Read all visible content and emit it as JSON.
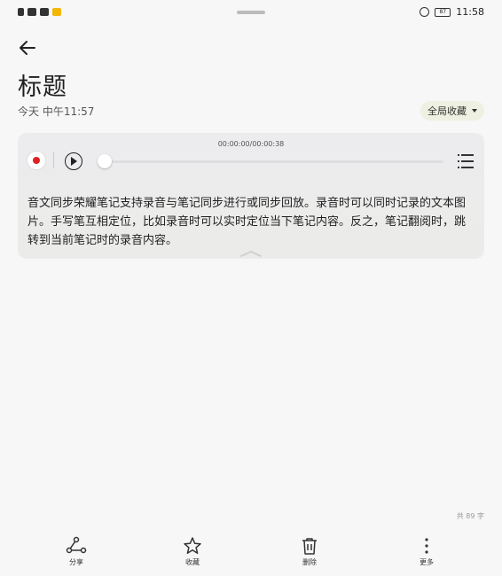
{
  "status_bar": {
    "time": "11:58",
    "battery": "87"
  },
  "note": {
    "title": "标题",
    "date": "今天 中午11:57",
    "category": "全局收藏",
    "body": "音文同步荣耀笔记支持录音与笔记同步进行或同步回放。录音时可以同时记录的文本图片。手写笔互相定位，比如录音时可以实时定位当下笔记内容。反之，笔记翻阅时，跳转到当前笔记时的录音内容。",
    "word_count": "共 89 字"
  },
  "player": {
    "time": "00:00:00/00:00:38",
    "progress": 0
  },
  "toolbar": {
    "share": "分享",
    "favorite": "收藏",
    "delete": "删除",
    "more": "更多"
  },
  "colors": {
    "record": "#e02020",
    "category_bg": "#eef0e1"
  }
}
